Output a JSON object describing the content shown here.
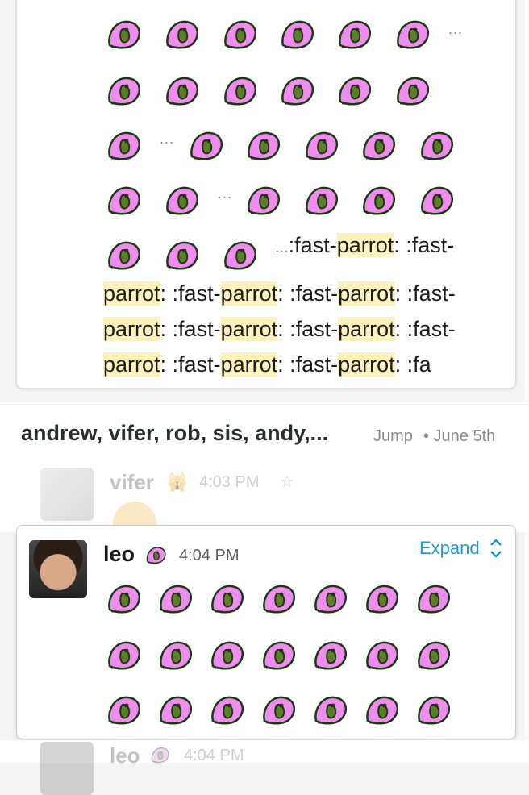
{
  "search_result": {
    "inline_dots_1": "...",
    "inline_dots_2": "...",
    "inline_dots_3": "...",
    "inline_dots_4": "...",
    "line1_pre": ":fast-",
    "line1_hl": "parrot",
    "line1_post": ": :fast-",
    "lines": [
      [
        ":fast-",
        "parrot",
        ": :fast-",
        "parrot",
        ": :fast-",
        "parrot",
        ": :fast-"
      ],
      [
        "",
        "parrot",
        ": :fast-",
        "parrot",
        ": :fast-",
        "parrot",
        ": :fast-"
      ],
      [
        "",
        "parrot",
        ": :fast-",
        "parrot",
        ": :fast-",
        "parrot",
        ": :fa"
      ]
    ]
  },
  "group": {
    "title": "andrew, vifer, rob, sis, andy,...",
    "jump": "Jump",
    "date": "• June 5th"
  },
  "vifer_message": {
    "author": "vifer",
    "status_emoji": "🙀",
    "time": "4:03 PM",
    "star": "☆"
  },
  "leo_message": {
    "author": "leo",
    "status_icon": "parrot-icon",
    "time": "4:04 PM",
    "expand_label": "Expand"
  },
  "leo_message_2": {
    "author": "leo",
    "time": "4:04 PM"
  },
  "colors": {
    "highlight": "#fdf1bc",
    "link": "#1d9bd1",
    "parrot_body": "#f08cf0",
    "parrot_outline": "#1a3a12"
  }
}
